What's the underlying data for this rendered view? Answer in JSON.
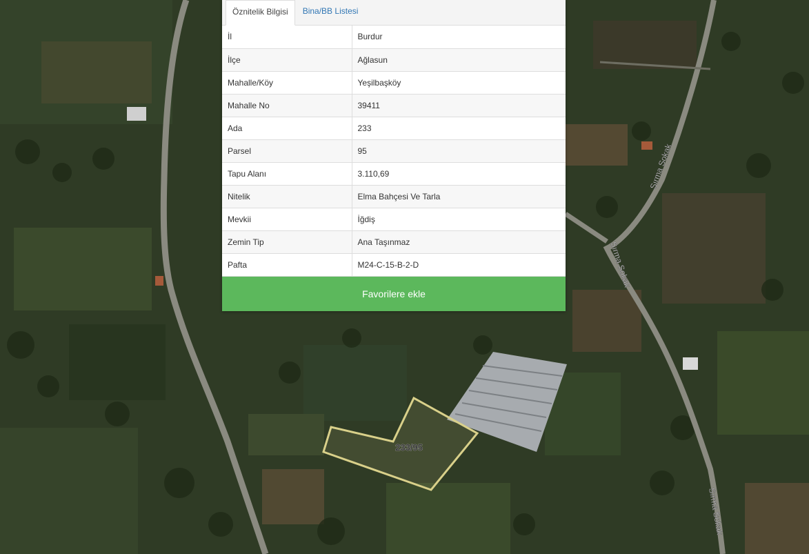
{
  "tabs": [
    {
      "label": "Öznitelik Bilgisi",
      "active": true
    },
    {
      "label": "Bina/BB Listesi",
      "active": false
    }
  ],
  "attributes": [
    {
      "key": "İl",
      "value": "Burdur"
    },
    {
      "key": "İlçe",
      "value": "Ağlasun"
    },
    {
      "key": "Mahalle/Köy",
      "value": "Yeşilbaşköy"
    },
    {
      "key": "Mahalle No",
      "value": "39411"
    },
    {
      "key": "Ada",
      "value": "233"
    },
    {
      "key": "Parsel",
      "value": "95"
    },
    {
      "key": "Tapu Alanı",
      "value": "3.110,69"
    },
    {
      "key": "Nitelik",
      "value": "Elma Bahçesi Ve Tarla"
    },
    {
      "key": "Mevkii",
      "value": "İğdiş"
    },
    {
      "key": "Zemin Tip",
      "value": "Ana Taşınmaz"
    },
    {
      "key": "Pafta",
      "value": "M24-C-15-B-2-D"
    }
  ],
  "favorite_button_label": "Favorilere ekle",
  "map": {
    "parcel_label": "233/95",
    "road_labels": [
      "Sırma Sokak",
      "Sırma Sokak",
      "Sırma Sokak"
    ]
  },
  "colors": {
    "button": "#5cb85c",
    "link": "#3277b4",
    "parcel_outline": "#d9d08a"
  }
}
